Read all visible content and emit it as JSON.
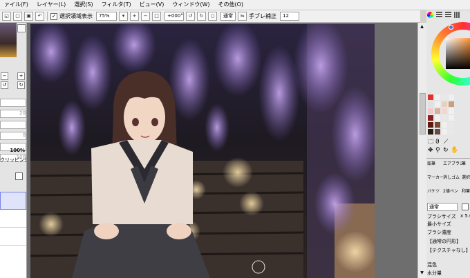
{
  "menubar": {
    "items": [
      "ァイル(F)",
      "レイヤー(L)",
      "選択(S)",
      "フィルタ(T)",
      "ビュー(V)",
      "ウィンドウ(W)",
      "その他(O)"
    ]
  },
  "toolbar": {
    "show_selection_label": "選択領域表示",
    "zoom": "75%",
    "rotation": "+000°",
    "blend": "通常",
    "stabilizer_label": "手ブレ補正",
    "stabilizer_value": "12"
  },
  "left_panel": {
    "values": [
      "20",
      "0",
      "100"
    ],
    "opacity": "100%",
    "clipping_label": "クリッピング"
  },
  "tools": {
    "row1": [
      "鉛筆",
      "エアブラシ",
      "筆"
    ],
    "row2": [
      "マーカー",
      "消しゴム",
      "選択"
    ],
    "row3": [
      "バケツ",
      "2値ペン",
      "和筆"
    ]
  },
  "brush": {
    "mode": "通常",
    "size_label": "ブラシサイズ",
    "size_value": "x 5.0",
    "min_size_label": "最小サイズ",
    "density_label": "ブラシ濃度",
    "shape": "【通常の円形】",
    "texture": "【テクスチャなし】",
    "mix_label": "混色",
    "water_label": "水分量"
  },
  "colors": {
    "accent": "#4a78c8",
    "swatches": [
      "#e03030",
      "#f0f0f0",
      "#e8e8e8",
      "#f0f0f0",
      "#e0e0e0",
      "#f0f0f0",
      "#e8d0c0",
      "#c8a080",
      "#f4c8c8",
      "#d8b0a0",
      "#f0d8d0",
      "#f0f0f0",
      "#8c2020",
      "#f0f0f0",
      "#e8e8e8",
      "#f0f0f0",
      "#5a1a10",
      "#7a4a30",
      "#f0f0f0",
      "#e8e8e8",
      "#2a1a10",
      "#6a4a40",
      "#f0f0f0",
      "#e8e8e8"
    ]
  }
}
